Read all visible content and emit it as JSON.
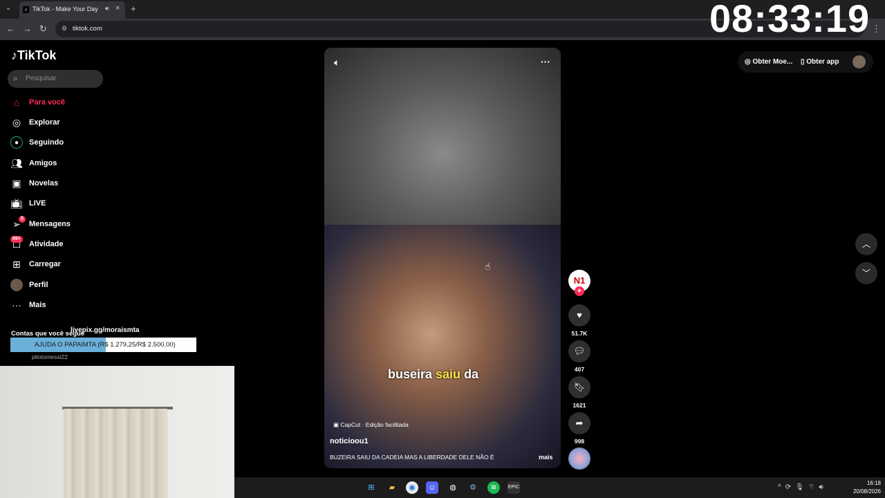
{
  "browser": {
    "tab_title": "TikTok - Make Your Day",
    "url": "tiktok.com",
    "new_tab": "+"
  },
  "overlay": {
    "clock": "08:33:19",
    "livepix": "livepix.gg/moraismta",
    "donation_text": "AJUDA O PAPAIMTA (R$ 1.279,25/R$ 2.500,00)",
    "donation_progress": 0.5117
  },
  "sidebar": {
    "logo": "TikTok",
    "search_placeholder": "Pesquisar",
    "items": [
      {
        "label": "Para você",
        "icon": "home-icon",
        "active": true
      },
      {
        "label": "Explorar",
        "icon": "compass-icon"
      },
      {
        "label": "Seguindo",
        "icon": "following-icon"
      },
      {
        "label": "Amigos",
        "icon": "friends-icon"
      },
      {
        "label": "Novelas",
        "icon": "novelas-icon"
      },
      {
        "label": "LIVE",
        "icon": "live-icon"
      },
      {
        "label": "Mensagens",
        "icon": "send-icon",
        "badge": "5"
      },
      {
        "label": "Atividade",
        "icon": "inbox-icon",
        "badge": "99+"
      },
      {
        "label": "Carregar",
        "icon": "upload-icon"
      },
      {
        "label": "Perfil",
        "icon": "profile-avatar"
      },
      {
        "label": "Mais",
        "icon": "more-icon"
      }
    ],
    "following_title": "Contas que você segue",
    "account": "pilotomessi22"
  },
  "video": {
    "caption_white_1": "buseira ",
    "caption_yellow": "saiu",
    "caption_white_2": " da",
    "capcut": "CapCut · Edição facilitada",
    "author": "noticioou1",
    "description": "BUZEIRA SAIU DA CADEIA MAS A LIBERDADE DELE NÃO É",
    "more": "mais",
    "creator_avatar_text": "N1"
  },
  "actions": {
    "likes": "51.7K",
    "comments": "407",
    "saves": "1621",
    "shares": "998"
  },
  "topright": {
    "coins": "Obter Moe...",
    "get_app": "Obter app"
  },
  "taskbar": {
    "time": "16:18",
    "date": "20/08/2026"
  },
  "colors": {
    "accent": "#fe2c55",
    "caption_highlight": "#f5e142",
    "donation_fill": "#6ab0d9"
  }
}
